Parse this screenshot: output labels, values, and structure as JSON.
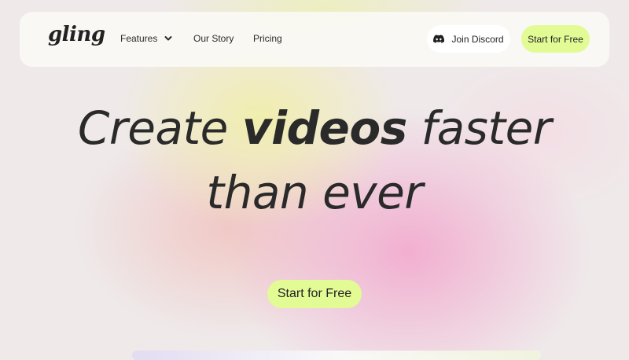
{
  "nav": {
    "logo": "gling",
    "items": [
      {
        "label": "Features",
        "has_dropdown": true
      },
      {
        "label": "Our Story"
      },
      {
        "label": "Pricing"
      }
    ],
    "discord_label": "Join Discord",
    "start_label": "Start for Free"
  },
  "hero": {
    "line1_pre": "Create ",
    "line1_bold": "videos",
    "line1_post": " faster",
    "line2": "than ever",
    "cta_label": "Start for Free"
  },
  "colors": {
    "cta": "#e2fb95",
    "text": "#2a2a2a",
    "navbar": "#faf9f4"
  },
  "icons": {
    "dropdown": "chevron-down-icon",
    "discord": "discord-icon"
  }
}
